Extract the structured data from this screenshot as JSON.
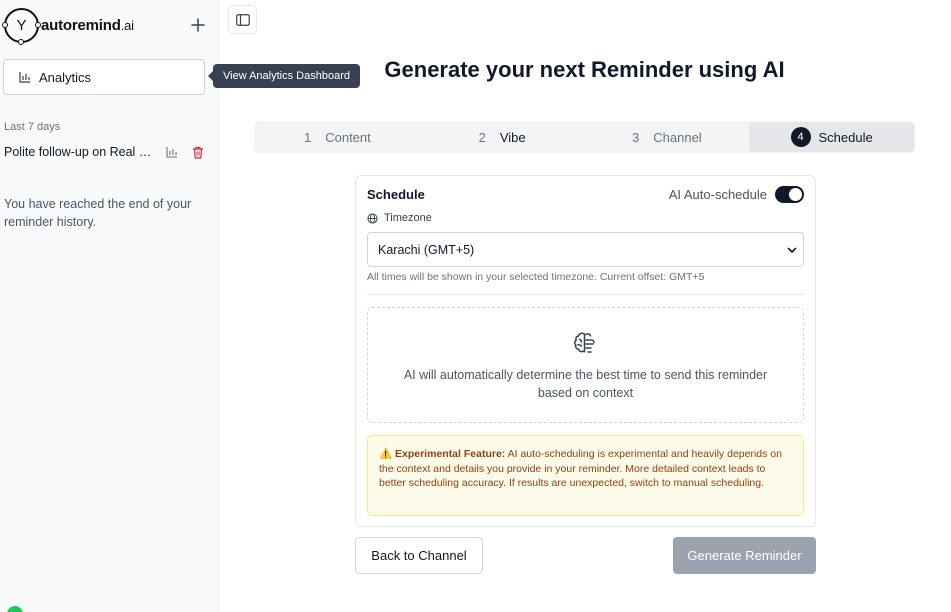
{
  "sidebar": {
    "logo": {
      "mark": "Y",
      "name": "autoremind",
      "suffix": ".ai"
    },
    "new_icon": "plus-icon",
    "analytics": {
      "label": "Analytics",
      "icon": "bar-chart-icon"
    },
    "tooltip": "View Analytics Dashboard",
    "section_label": "Last 7 days",
    "history": [
      {
        "title": "Polite follow-up on Real Estate Listing",
        "icons": [
          "bar-chart-icon",
          "trash-icon"
        ]
      }
    ],
    "end_message": "You have reached the end of your reminder history."
  },
  "header": {
    "toggle_icon": "sidebar-toggle-icon",
    "title": "Generate your next Reminder using AI"
  },
  "steps": [
    {
      "num": "1",
      "label": "Content",
      "state": "done"
    },
    {
      "num": "2",
      "label": "Vibe",
      "state": "done"
    },
    {
      "num": "3",
      "label": "Channel",
      "state": "done"
    },
    {
      "num": "4",
      "label": "Schedule",
      "state": "active"
    }
  ],
  "schedule": {
    "title": "Schedule",
    "auto_label": "AI Auto-schedule",
    "auto_enabled": true,
    "timezone_label": "Timezone",
    "timezone_value": "Karachi (GMT+5)",
    "timezone_help": "All times will be shown in your selected timezone. Current offset: GMT+5",
    "ai_message": "AI will automatically determine the best time to send this reminder based on context",
    "warning_title": "Experimental Feature:",
    "warning_text": "AI auto-scheduling is experimental and heavily depends on the context and details you provide in your reminder. More detailed context leads to better scheduling accuracy. If results are unexpected, switch to manual scheduling.",
    "warning_icon": "⚠️"
  },
  "actions": {
    "back": "Back to Channel",
    "generate": "Generate Reminder"
  },
  "colors": {
    "primary": "#111827",
    "disabled": "#9ca3af",
    "delete": "#dc2626",
    "warning_bg": "#fffbeb",
    "warning_text": "#92400e"
  }
}
